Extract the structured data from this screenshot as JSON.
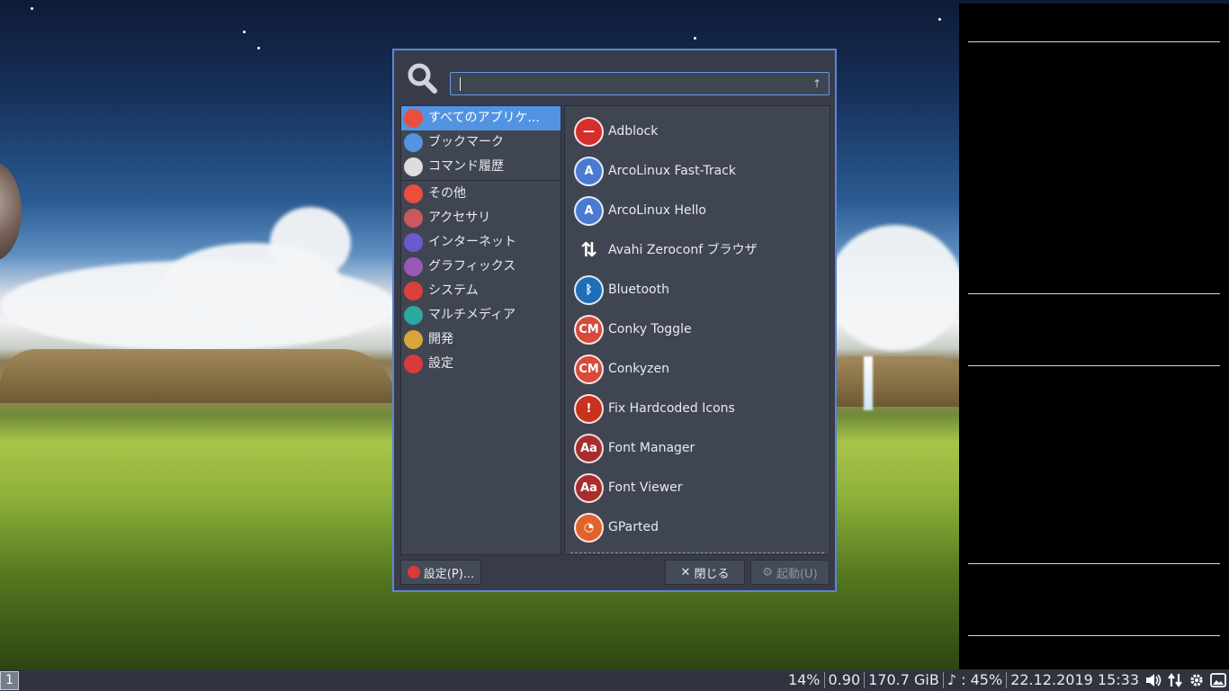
{
  "menu": {
    "search": {
      "value": "",
      "placeholder": ""
    },
    "categories": [
      {
        "label": "すべてのアプリケ...",
        "icon": "all-apps-icon",
        "color": "#e94f3a",
        "selected": true
      },
      {
        "label": "ブックマーク",
        "icon": "bookmark-folder-icon",
        "color": "#5294e2"
      },
      {
        "label": "コマンド履歴",
        "icon": "gears-icon",
        "color": "#dddddd"
      },
      {
        "label": "その他",
        "icon": "other-icon",
        "color": "#e94f3a"
      },
      {
        "label": "アクセサリ",
        "icon": "accessories-icon",
        "color": "#c9595d"
      },
      {
        "label": "インターネット",
        "icon": "internet-icon",
        "color": "#6a5acd"
      },
      {
        "label": "グラフィックス",
        "icon": "graphics-icon",
        "color": "#9b59b6"
      },
      {
        "label": "システム",
        "icon": "system-icon",
        "color": "#d9413a"
      },
      {
        "label": "マルチメディア",
        "icon": "multimedia-icon",
        "color": "#2ca8a0"
      },
      {
        "label": "開発",
        "icon": "development-icon",
        "color": "#d8a53a"
      },
      {
        "label": "設定",
        "icon": "settings-icon",
        "color": "#d93a3a"
      }
    ],
    "apps": [
      {
        "label": "Adblock",
        "icon": "adblock-icon",
        "color": "#d62d2d",
        "glyph": "—"
      },
      {
        "label": "ArcoLinux Fast-Track",
        "icon": "arcolinux-icon",
        "color": "#4a7bd0",
        "glyph": "A"
      },
      {
        "label": "ArcoLinux Hello",
        "icon": "arcolinux-icon",
        "color": "#4a7bd0",
        "glyph": "A"
      },
      {
        "label": "Avahi Zeroconf ブラウザ",
        "icon": "avahi-arrows-icon",
        "color": "transparent",
        "glyph": "⇅"
      },
      {
        "label": "Bluetooth",
        "icon": "bluetooth-icon",
        "color": "#1f6fb8",
        "glyph": "ᛒ"
      },
      {
        "label": "Conky Toggle",
        "icon": "conky-icon",
        "color": "#d84a3a",
        "glyph": "CM"
      },
      {
        "label": "Conkyzen",
        "icon": "conky-icon",
        "color": "#d84a3a",
        "glyph": "CM"
      },
      {
        "label": "Fix Hardcoded Icons",
        "icon": "fix-icons-icon",
        "color": "#c8321e",
        "glyph": "!"
      },
      {
        "label": "Font Manager",
        "icon": "font-manager-icon",
        "color": "#a82e2e",
        "glyph": "Aa"
      },
      {
        "label": "Font Viewer",
        "icon": "font-viewer-icon",
        "color": "#a82e2e",
        "glyph": "Aa"
      },
      {
        "label": "GParted",
        "icon": "gparted-icon",
        "color": "#e0632e",
        "glyph": "◔"
      }
    ],
    "buttons": {
      "settings": "設定(P)...",
      "close": "閉じる",
      "launch": "起動(U)"
    }
  },
  "taskbar": {
    "workspace": "1",
    "cpu": "14%",
    "load": "0.90",
    "disk": "170.7 GiB",
    "volume": "♪ : 45%",
    "datetime": "22.12.2019 15:33"
  }
}
